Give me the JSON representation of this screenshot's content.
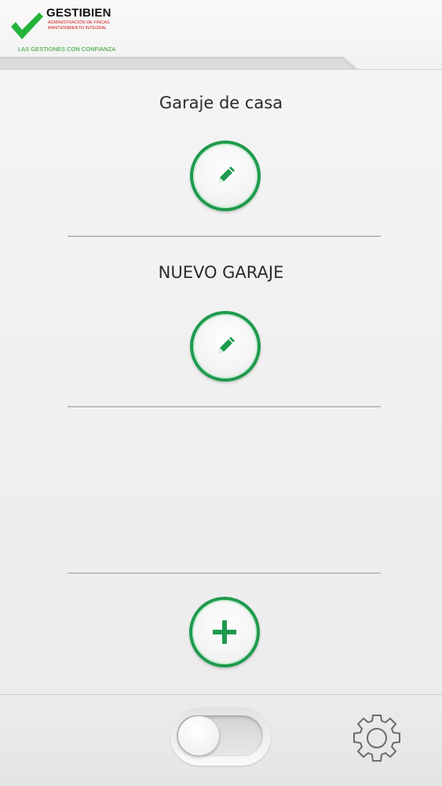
{
  "header": {
    "brand": "GESTIBIEN",
    "sub_line_1": "ADMINISTRACIÓN DE FINCAS",
    "sub_line_2": "MANTENIMIENTO INTEGRAL",
    "slogan": "LAS GESTIONES CON CONFIANZA"
  },
  "garages": [
    {
      "name": "Garaje de casa",
      "action_icon": "pencil-icon"
    },
    {
      "name": "NUEVO GARAJE",
      "action_icon": "pencil-icon"
    }
  ],
  "add_button": {
    "icon": "plus-icon"
  },
  "footer": {
    "toggle": {
      "state": "off"
    },
    "settings_icon": "gear-icon"
  },
  "colors": {
    "accent_green": "#1f9a4e",
    "brand_red": "#d01818",
    "slogan_green": "#2a9d2a"
  }
}
